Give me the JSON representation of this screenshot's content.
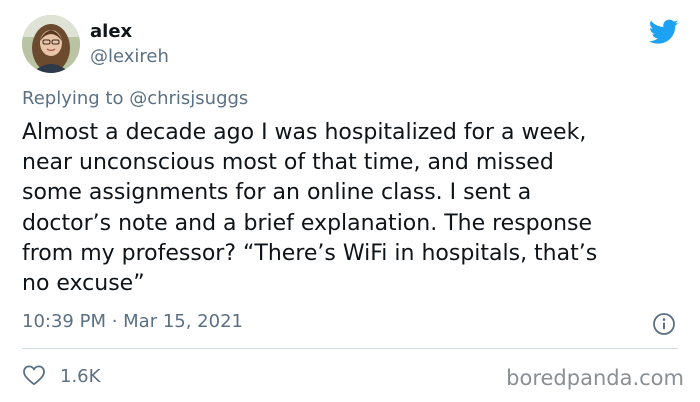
{
  "author": {
    "name": "alex",
    "handle": "@lexireh"
  },
  "reply": {
    "prefix": "Replying to ",
    "mention": "@chrisjsuggs"
  },
  "tweet": {
    "lines": [
      "Almost a decade ago I was hospitalized for a week,",
      "near unconscious most of that time, and missed",
      "some assignments for an online class. I sent a",
      "doctor’s note and a brief explanation. The response",
      "from my professor? “There’s WiFi in hospitals, that’s",
      "no excuse”"
    ]
  },
  "meta": {
    "time": "10:39 PM",
    "separator": " · ",
    "date": "Mar 15, 2021"
  },
  "engagement": {
    "likes": "1.6K"
  },
  "watermark": "boredpanda.com",
  "icons": {
    "logo": "twitter-bird-icon",
    "info": "info-icon",
    "like": "heart-icon"
  },
  "colors": {
    "twitter_blue": "#1da1f2",
    "secondary_text": "#5b7083",
    "primary_text": "#0f1419",
    "divider": "#cfd9de"
  }
}
